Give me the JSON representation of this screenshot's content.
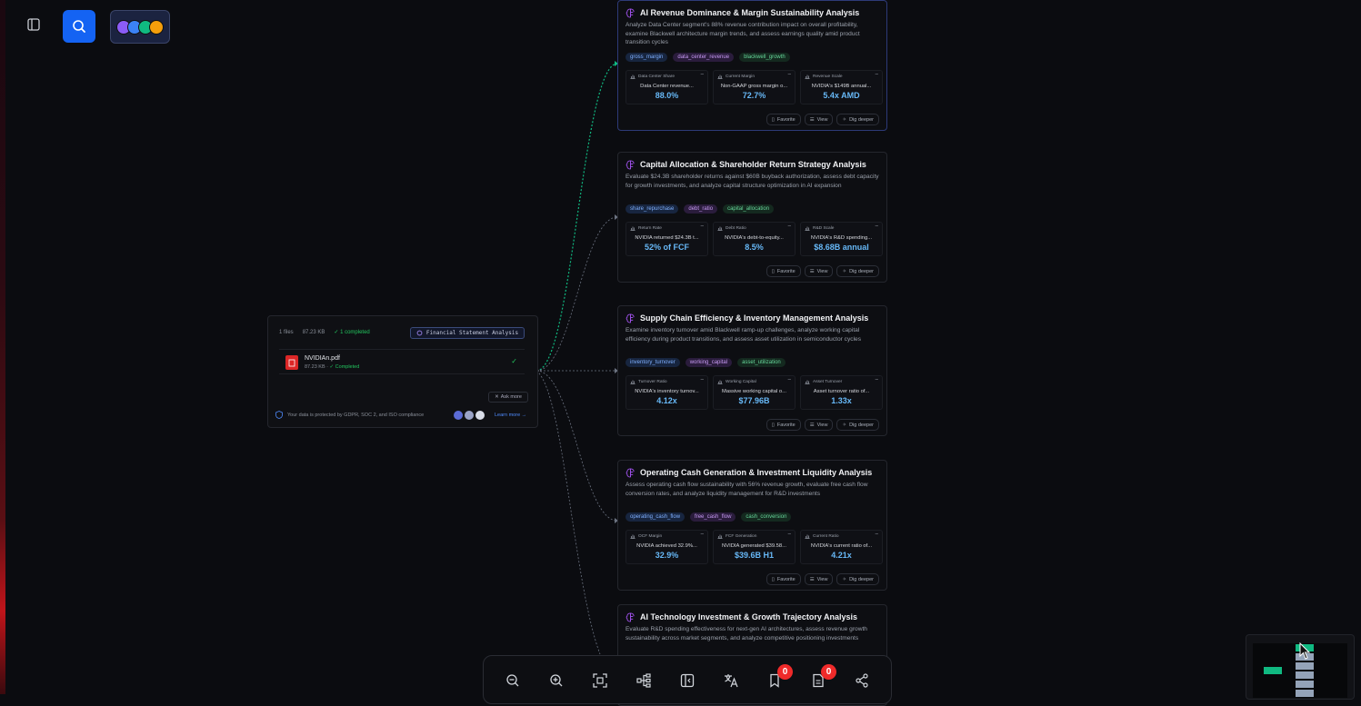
{
  "header": {
    "sidebar_toggle_icon": "sidebar-icon",
    "search_icon": "search-icon",
    "avatar_colors": [
      "#8b5cf6",
      "#3b82f6",
      "#10b981",
      "#f59e0b"
    ]
  },
  "source": {
    "files_count": "1 files",
    "size": "87.23 KB",
    "completed": "✓ 1 completed",
    "analysis_type": "Financial Statement Analysis",
    "file_name": "NVIDIAn.pdf",
    "file_size": "87.23 KB",
    "file_status": "✓ Completed",
    "ask_more": "Ask more",
    "privacy": "Your data is protected by GDPR, SOC 2, and ISO compliance",
    "learn_more": "Learn more →"
  },
  "action_labels": {
    "favorite": "Favorite",
    "view": "View",
    "dig": "Dig deeper"
  },
  "cards": [
    {
      "title": "AI Revenue Dominance & Margin Sustainability Analysis",
      "desc": "Analyze Data Center segment's 88% revenue contribution impact on overall profitability, examine Blackwell architecture margin trends, and assess earnings quality amid product transition cycles",
      "tags": [
        "gross_margin",
        "data_center_revenue",
        "blackwell_growth"
      ],
      "metrics": [
        {
          "label": "Data Center Share",
          "desc": "Data Center revenue...",
          "value": "88.0%"
        },
        {
          "label": "Current Margin",
          "desc": "Non-GAAP gross margin o...",
          "value": "72.7%"
        },
        {
          "label": "Revenue Scale",
          "desc": "NVIDIA's $149B annual...",
          "value": "5.4x AMD"
        }
      ]
    },
    {
      "title": "Capital Allocation & Shareholder Return Strategy Analysis",
      "desc": "Evaluate $24.3B shareholder returns against $60B buyback authorization, assess debt capacity for growth investments, and analyze capital structure optimization in AI expansion",
      "tags": [
        "share_repurchase",
        "debt_ratio",
        "capital_allocation"
      ],
      "metrics": [
        {
          "label": "Return Rate",
          "desc": "NVIDIA returned $24.3B t...",
          "value": "52% of FCF"
        },
        {
          "label": "Debt Ratio",
          "desc": "NVIDIA's debt-to-equity...",
          "value": "8.5%"
        },
        {
          "label": "R&D Scale",
          "desc": "NVIDIA's R&D spending...",
          "value": "$8.68B annual"
        }
      ]
    },
    {
      "title": "Supply Chain Efficiency & Inventory Management Analysis",
      "desc": "Examine inventory turnover amid Blackwell ramp-up challenges, analyze working capital efficiency during product transitions, and assess asset utilization in semiconductor cycles",
      "tags": [
        "inventory_turnover",
        "working_capital",
        "asset_utilization"
      ],
      "metrics": [
        {
          "label": "Turnover Ratio",
          "desc": "NVIDIA's inventory turnov...",
          "value": "4.12x"
        },
        {
          "label": "Working Capital",
          "desc": "Massive working capital o...",
          "value": "$77.96B"
        },
        {
          "label": "Asset Turnover",
          "desc": "Asset turnover ratio of...",
          "value": "1.33x"
        }
      ]
    },
    {
      "title": "Operating Cash Generation & Investment Liquidity Analysis",
      "desc": "Assess operating cash flow sustainability with 56% revenue growth, evaluate free cash flow conversion rates, and analyze liquidity management for R&D investments",
      "tags": [
        "operating_cash_flow",
        "free_cash_flow",
        "cash_conversion"
      ],
      "metrics": [
        {
          "label": "OCF Margin",
          "desc": "NVIDIA achieved 32.9%...",
          "value": "32.9%"
        },
        {
          "label": "FCF Generation",
          "desc": "NVIDIA generated $39.58...",
          "value": "$39.6B H1"
        },
        {
          "label": "Current Ratio",
          "desc": "NVIDIA's current ratio of...",
          "value": "4.21x"
        }
      ]
    },
    {
      "title": "AI Technology Investment & Growth Trajectory Analysis",
      "desc": "Evaluate R&D spending effectiveness for next-gen AI architectures, assess revenue growth sustainability across market segments, and analyze competitive positioning investments",
      "tags": [],
      "metrics": []
    }
  ],
  "toolbar": {
    "buttons": [
      "zoom-out-icon",
      "zoom-in-icon",
      "fit-screen-icon",
      "tree-layout-icon",
      "panel-icon",
      "translate-icon",
      "bookmark-icon",
      "document-icon",
      "share-icon"
    ],
    "bookmark_count": "0",
    "document_count": "0"
  },
  "colors": {
    "accent_blue": "#1463f3",
    "edge_green": "#10b981",
    "value_blue": "#67b8f7",
    "badge_red": "#ef2a2a"
  }
}
